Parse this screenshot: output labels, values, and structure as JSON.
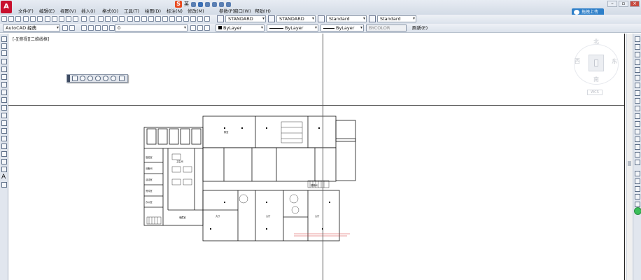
{
  "app": {
    "logo_letter": "A"
  },
  "menu": [
    {
      "label": "文件(F)"
    },
    {
      "label": "编辑(E)"
    },
    {
      "label": "视图(V)"
    },
    {
      "label": "插入(I)"
    },
    {
      "label": "格式(O)"
    },
    {
      "label": "工具(T)"
    },
    {
      "label": "绘图(D)"
    },
    {
      "label": "标注(N)"
    },
    {
      "label": "修改(M)"
    },
    {
      "label": "参数(P)"
    },
    {
      "label": "窗口(W)"
    },
    {
      "label": "帮助(H)"
    }
  ],
  "ime": {
    "logo": "S",
    "lang": "英"
  },
  "share_button": {
    "label": "拖拽上传"
  },
  "toolbar1": {
    "text_style": "STANDARD",
    "dim_style": "STANDARD",
    "table_style": "Standard",
    "mleader_style": "Standard"
  },
  "toolbar2": {
    "workspace": "AutoCAD 经典",
    "layer": "0",
    "color": "ByLayer",
    "linetype": "ByLayer",
    "lineweight": "ByLayer",
    "plotstyle": "BYCOLOR",
    "refresh": "刷新(E)"
  },
  "viewport": {
    "label": "[-][俯视][二维线框]"
  },
  "viewcube": {
    "north": "北",
    "south": "南",
    "east": "东",
    "west": "西",
    "wcs": "WCS"
  },
  "plan_rooms": [
    "值班室",
    "设备间",
    "活动室",
    "资料室",
    "办公室",
    "教室",
    "卫生间",
    "储藏室",
    "楼梯间",
    "大厅"
  ],
  "colors": {
    "accent": "#2e7fc9",
    "menubar": "#dde3ec",
    "canvas": "#ffffff",
    "redtext": "#d63a3a"
  }
}
